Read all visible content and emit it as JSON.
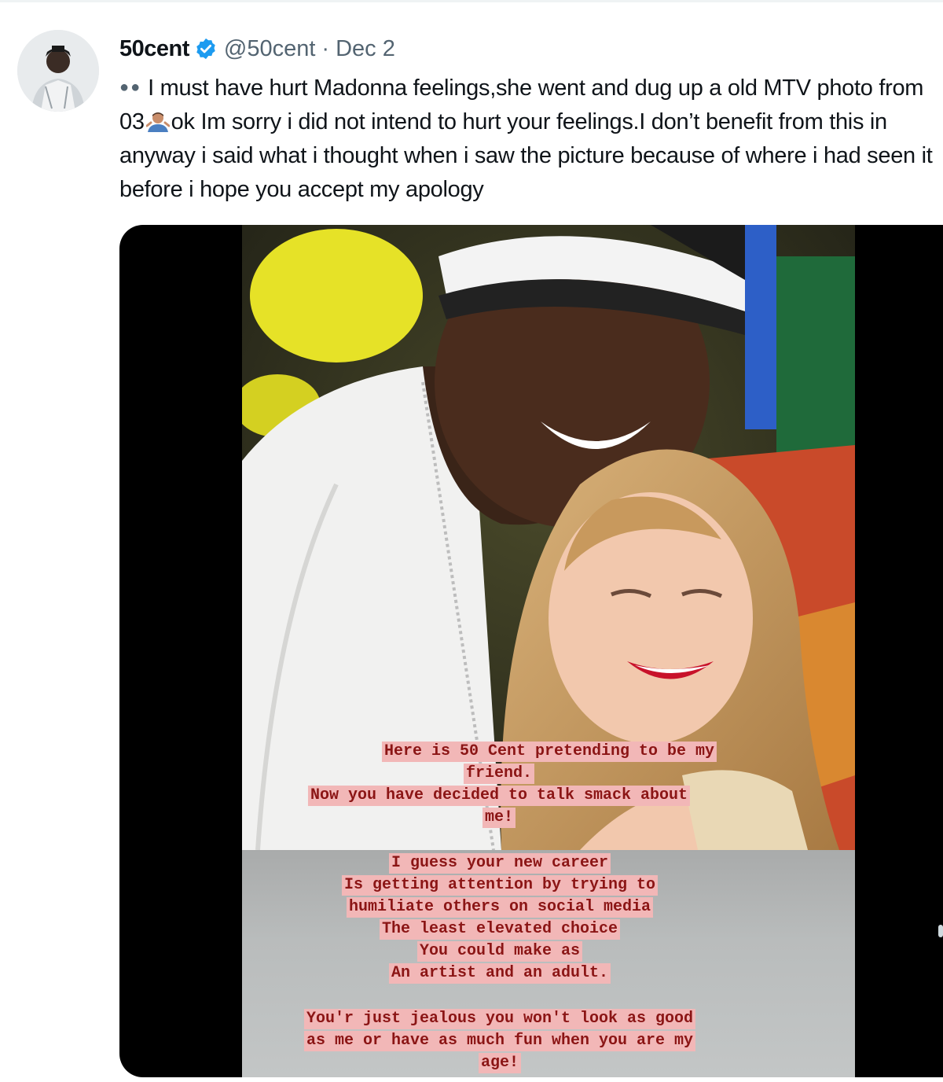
{
  "tweet": {
    "display_name": "50cent",
    "handle": "@50cent",
    "separator": "·",
    "date": "Dec 2",
    "verified_icon": "verified-badge-icon",
    "text_lead_icon": "eyes-emoji-icon",
    "text_part1": "I must have hurt Madonna feelings,she went and dug up a old MTV photo from 03",
    "text_icon": "man-shrugging-emoji-icon",
    "text_part2": "ok Im sorry i did not intend to hurt your feelings.I don’t benefit from this in anyway i said what i thought when i saw the picture because of where i had seen it before i hope you accept my apology"
  },
  "media": {
    "story_caption_top": [
      "Here is 50 Cent pretending to be my",
      "friend.",
      "Now you have decided to talk smack about",
      "me!"
    ],
    "story_caption_bottom": [
      "I guess your  new career",
      "Is getting attention by trying to",
      "humiliate others on social media",
      "The least elevated choice",
      "You could make as",
      "An artist and an adult."
    ],
    "story_caption_final": [
      "You'r just jealous you won't look as good",
      "as me or have as much fun when you are my",
      "age!"
    ]
  },
  "colors": {
    "accent_verified": "#1d9bf0",
    "text_primary": "#0f1419",
    "text_secondary": "#536471",
    "caption_text": "#8b1515",
    "caption_highlight": "#f2b7b7"
  }
}
